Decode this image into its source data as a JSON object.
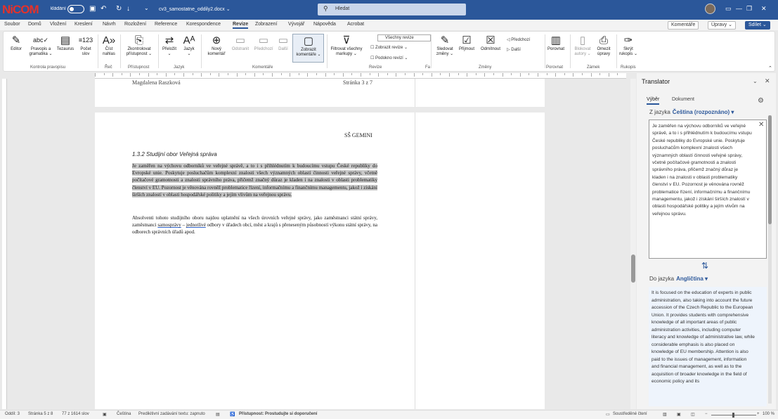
{
  "titlebar": {
    "logo": "NiCOM",
    "autosave_label": "Automatické ukládání",
    "doc_title": "cv3_samostatne_oddily2.docx ⌄",
    "search_placeholder": "Hledat",
    "colors": {
      "accent": "#2b579a",
      "logo": "#e4322b"
    }
  },
  "tabs": [
    "Soubor",
    "Domů",
    "Vložení",
    "Kreslení",
    "Návrh",
    "Rozložení",
    "Reference",
    "Korespondence",
    "Revize",
    "Zobrazení",
    "Vývojář",
    "Nápověda",
    "Acrobat"
  ],
  "active_tab": "Revize",
  "top_buttons": {
    "comments": "Komentáře",
    "edits": "Úpravy ⌄",
    "share": "Sdílet ⌄"
  },
  "ribbon": {
    "editor": "Editor",
    "spelling": "Pravopis a gramatika ⌄",
    "thesaurus": "Tezaurus",
    "word_count": "Počet slov",
    "read_aloud": "Číst nahlas",
    "check_access": "Zkontrolovat přístupnost ⌄",
    "translate": "Přeložit ⌄",
    "language": "Jazyk ⌄",
    "new_comment": "Nový komentář",
    "delete": "Odstranit",
    "previous": "Předchozí",
    "next": "Další",
    "show_comments": "Zobrazit komentáře ⌄",
    "track_changes": "Sledovat změny ⌄",
    "all_revisions": "Všechny revize",
    "show_markup": "Zobrazit revize ⌄",
    "review_pane": "Podokno revizí ⌄",
    "filter_markup": "Filtrovat všechny markupy ⌄",
    "accept": "Přijmout",
    "reject": "Odmítnout",
    "prev_change": "Předchozí",
    "next_change": "Další",
    "compare": "Porovnat",
    "block_authors": "Blokovat autory ⌄",
    "restrict_editing": "Omezit úpravy",
    "hide_ink": "Skrýt rukopis ⌄",
    "groups": {
      "proofing": "Kontrola pravopisu",
      "speech": "Řeč",
      "accessibility": "Přístupnost",
      "language": "Jazyk",
      "comments": "Komentáře",
      "tracking": "Revize",
      "changes": "Změny",
      "compare": "Porovnat",
      "protect": "Zámek",
      "ink": "Rukopis",
      "fa": "Fa"
    }
  },
  "document": {
    "header_name": "Magdalena Raszková",
    "header_page": "Stránka 3 z 7",
    "school": "SŠ GEMINI",
    "heading": "1.3.2   Studijní obor Veřejná správa",
    "para1": "Je zaměřen na výchovu odborníků ve veřejné správě, a to i s přihlédnutím k budoucímu vstupu České republiky do Evropské unie. Poskytuje posluchačům komplexní znalosti všech významných oblastí činnosti veřejné správy, včetně počítačové gramotnosti a znalosti správního práva, přičemž značný důraz je kladen i na znalosti v oblasti problematiky členství v EU. Pozornost je věnována rovněž problematice řízení, informačnímu a finančnímu managementu, jakož i získání širších znalostí v oblasti hospodářské politiky a jejím vlivům na veřejnou správu.",
    "para2_start": "Absolventi tohoto studijního oboru najdou uplatnění na všech úrovních veřejné správy, jako zaměstnanci státní správy, zaměstnanci ",
    "para2_u1": "samosprávy",
    "para2_mid": " – ",
    "para2_u2": "jednotlivé",
    "para2_end": " odbory v úřadech obcí, měst a krajů s přeneseným působností výkonu státní správy, na odborech správních úřadů apod."
  },
  "translator": {
    "title": "Translator",
    "tab_selection": "Výběr",
    "tab_document": "Dokument",
    "from_label": "Z jazyka",
    "from_lang": "Čeština (rozpoznáno) ▾",
    "source_text": "Je zaměřen na výchovu odborníků ve veřejné správě, a to i s přihlédnutím k budoucímu vstupu České republiky do Evropské unie. Poskytuje posluchačům komplexní znalosti všech významných oblastí činnosti veřejné správy, včetně počítačové gramotnosti a znalosti správního práva, přičemž značný důraz je kladen i na znalosti v oblasti problematiky členství v EU. Pozornost je věnována rovněž problematice řízení, informačnímu a finančnímu managementu, jakož i získání širších znalostí v oblasti hospodářské politiky a jejím vlivům na veřejnou správu.",
    "to_label": "Do jazyka",
    "to_lang": "Angličtina ▾",
    "target_text": "It is focused on the education of experts in public administration, also taking into account the future accession of the Czech Republic to the European Union. It provides students with comprehensive knowledge of all important areas of public administration activities, including computer literacy and knowledge of administrative law, while considerable emphasis is also placed on knowledge of EU membership. Attention is also paid to the issues of management, information and financial management, as well as to the acquisition of broader knowledge in the field of economic policy and its"
  },
  "status": {
    "section": "Oddíl: 3",
    "page": "Stránka 5 z 8",
    "words": "77 z 1614 slov",
    "language": "Čeština",
    "predictive": "Predikitivní zadávání textu: zapnuto",
    "accessibility": "Přístupnost: Prostudujte si doporučení",
    "focus": "Soustředěné čtení",
    "zoom": "100 %"
  }
}
